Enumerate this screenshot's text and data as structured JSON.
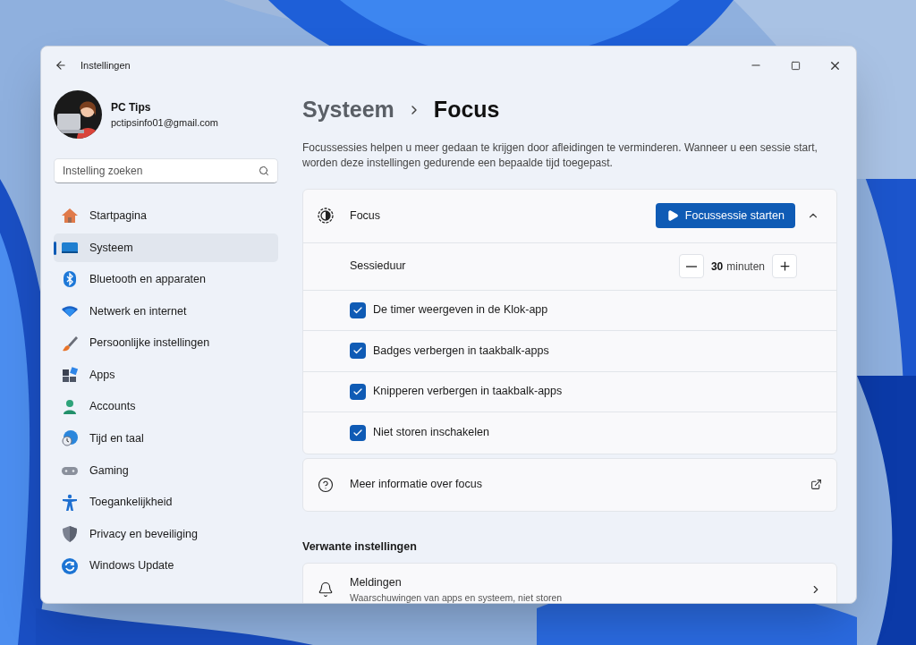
{
  "window": {
    "title": "Instellingen"
  },
  "user": {
    "name": "PC Tips",
    "email": "pctipsinfo01@gmail.com"
  },
  "search": {
    "placeholder": "Instelling zoeken"
  },
  "nav": [
    {
      "label": "Startpagina",
      "selected": false
    },
    {
      "label": "Systeem",
      "selected": true
    },
    {
      "label": "Bluetooth en apparaten",
      "selected": false
    },
    {
      "label": "Netwerk en internet",
      "selected": false
    },
    {
      "label": "Persoonlijke instellingen",
      "selected": false
    },
    {
      "label": "Apps",
      "selected": false
    },
    {
      "label": "Accounts",
      "selected": false
    },
    {
      "label": "Tijd en taal",
      "selected": false
    },
    {
      "label": "Gaming",
      "selected": false
    },
    {
      "label": "Toegankelijkheid",
      "selected": false
    },
    {
      "label": "Privacy en beveiliging",
      "selected": false
    },
    {
      "label": "Windows Update",
      "selected": false
    }
  ],
  "breadcrumb": [
    "Systeem",
    "Focus"
  ],
  "description": "Focussessies helpen u meer gedaan te krijgen door afleidingen te verminderen. Wanneer u een sessie start, worden deze instellingen gedurende een bepaalde tijd toegepast.",
  "focus_card": {
    "title": "Focus",
    "button": "Focussessie starten",
    "expanded": true,
    "duration": {
      "label": "Sessieduur",
      "value": "30",
      "unit": "minuten"
    },
    "options": [
      {
        "label": "De timer weergeven in de Klok-app",
        "checked": true
      },
      {
        "label": "Badges verbergen in taakbalk-apps",
        "checked": true
      },
      {
        "label": "Knipperen verbergen in taakbalk-apps",
        "checked": true
      },
      {
        "label": "Niet storen inschakelen",
        "checked": true
      }
    ]
  },
  "info_link": "Meer informatie over focus",
  "related": {
    "heading": "Verwante instellingen",
    "items": [
      {
        "title": "Meldingen",
        "subtitle": "Waarschuwingen van apps en systeem, niet storen"
      }
    ]
  }
}
